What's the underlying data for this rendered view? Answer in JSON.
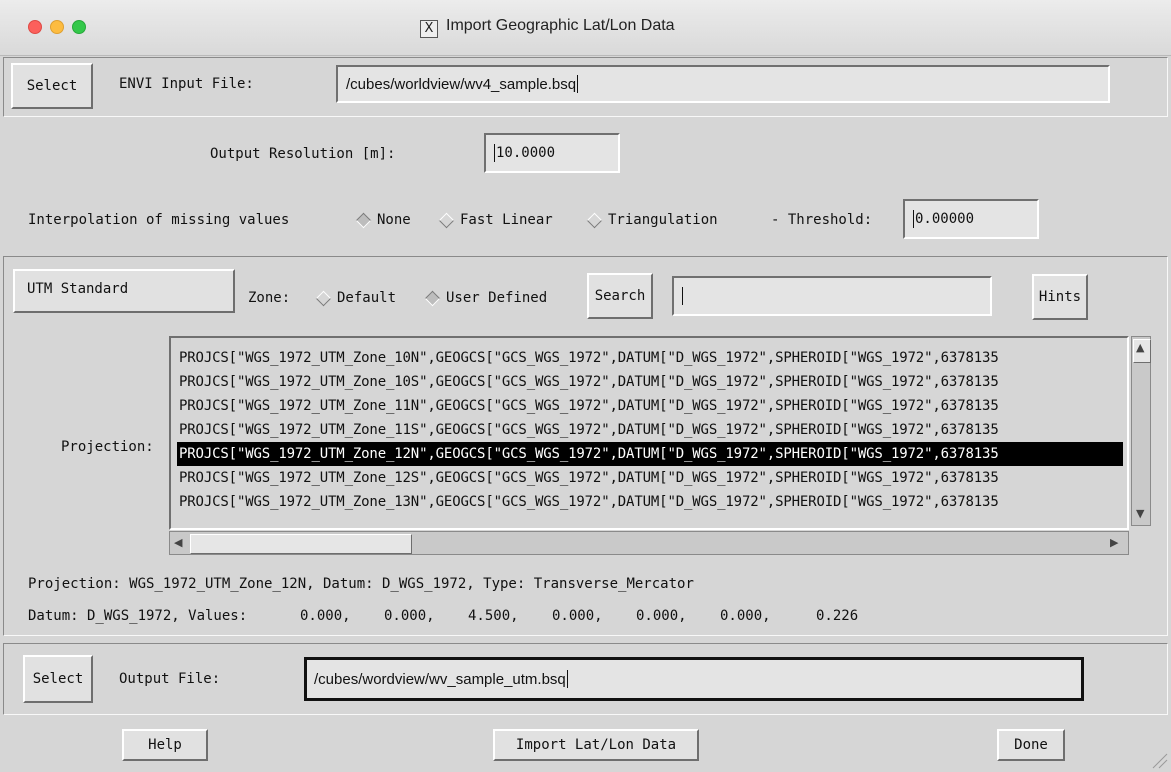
{
  "window": {
    "title": "Import Geographic Lat/Lon Data"
  },
  "input_file": {
    "select_label": "Select",
    "label": "ENVI Input File:",
    "value": "/cubes/worldview/wv4_sample.bsq"
  },
  "resolution": {
    "label": "Output Resolution [m]:",
    "value": "10.0000"
  },
  "interpolation": {
    "label": "Interpolation of missing values",
    "options": [
      "None",
      "Fast Linear",
      "Triangulation"
    ],
    "selected": "None",
    "threshold_label": "- Threshold:",
    "threshold_value": "0.00000"
  },
  "projection_type_button": "UTM Standard",
  "zone": {
    "label": "Zone:",
    "options": [
      "Default",
      "User Defined"
    ],
    "selected": "User Defined"
  },
  "search": {
    "button_label": "Search",
    "value": ""
  },
  "hints_label": "Hints",
  "projection": {
    "label": "Projection:",
    "items": [
      "PROJCS[\"WGS_1972_UTM_Zone_10N\",GEOGCS[\"GCS_WGS_1972\",DATUM[\"D_WGS_1972\",SPHEROID[\"WGS_1972\",6378135",
      "PROJCS[\"WGS_1972_UTM_Zone_10S\",GEOGCS[\"GCS_WGS_1972\",DATUM[\"D_WGS_1972\",SPHEROID[\"WGS_1972\",6378135",
      "PROJCS[\"WGS_1972_UTM_Zone_11N\",GEOGCS[\"GCS_WGS_1972\",DATUM[\"D_WGS_1972\",SPHEROID[\"WGS_1972\",6378135",
      "PROJCS[\"WGS_1972_UTM_Zone_11S\",GEOGCS[\"GCS_WGS_1972\",DATUM[\"D_WGS_1972\",SPHEROID[\"WGS_1972\",6378135",
      "PROJCS[\"WGS_1972_UTM_Zone_12N\",GEOGCS[\"GCS_WGS_1972\",DATUM[\"D_WGS_1972\",SPHEROID[\"WGS_1972\",6378135",
      "PROJCS[\"WGS_1972_UTM_Zone_12S\",GEOGCS[\"GCS_WGS_1972\",DATUM[\"D_WGS_1972\",SPHEROID[\"WGS_1972\",6378135",
      "PROJCS[\"WGS_1972_UTM_Zone_13N\",GEOGCS[\"GCS_WGS_1972\",DATUM[\"D_WGS_1972\",SPHEROID[\"WGS_1972\",6378135"
    ],
    "selected_index": 4
  },
  "info": {
    "projection_line": "Projection: WGS_1972_UTM_Zone_12N, Datum: D_WGS_1972, Type: Transverse_Mercator",
    "datum_label": "Datum: D_WGS_1972, Values:",
    "datum_values": [
      "0.000,",
      "0.000,",
      "4.500,",
      "0.000,",
      "0.000,",
      "0.000,",
      "0.226"
    ]
  },
  "output_file": {
    "select_label": "Select",
    "label": "Output File:",
    "value": "/cubes/wordview/wv_sample_utm.bsq"
  },
  "buttons": {
    "help": "Help",
    "import": "Import Lat/Lon Data",
    "done": "Done"
  }
}
